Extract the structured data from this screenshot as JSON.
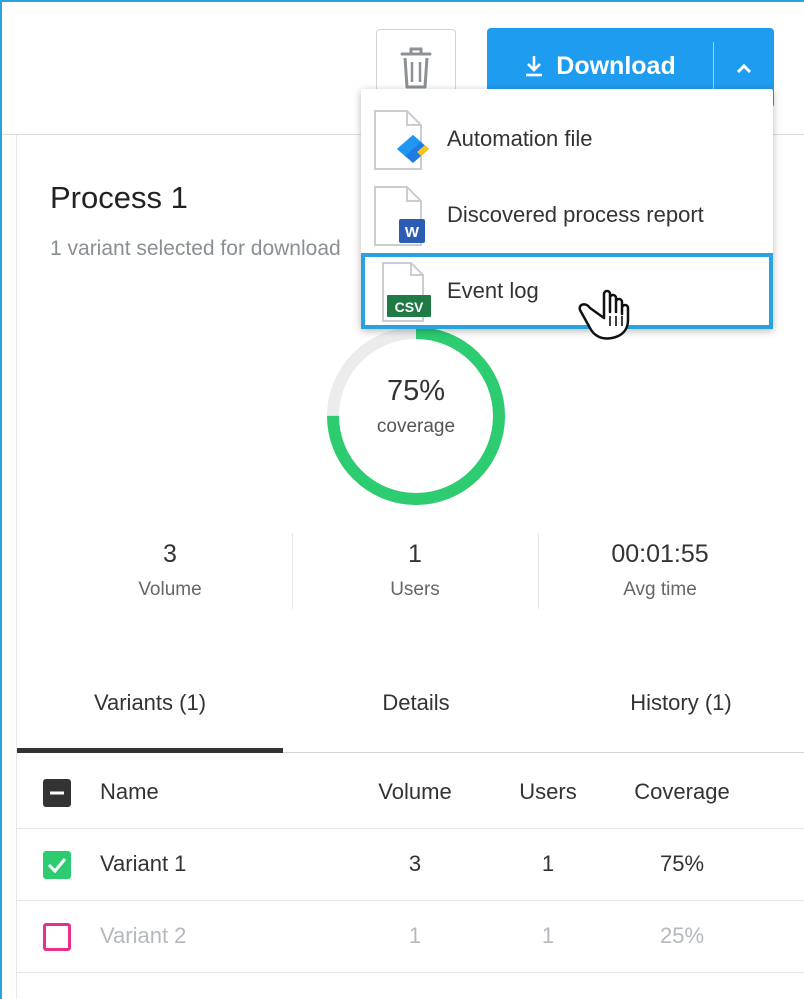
{
  "toolbar": {
    "delete_icon": "trash-icon",
    "download_label": "Download",
    "download_icon": "download-arrow-icon",
    "dropdown_icon": "chevron-up-icon",
    "accent_color": "#1e9cf0"
  },
  "download_menu": {
    "items": [
      {
        "label": "Automation file",
        "icon": "automation-file-icon"
      },
      {
        "label": "Discovered process report",
        "icon": "word-document-icon",
        "badge": "W"
      },
      {
        "label": "Event log",
        "icon": "csv-file-icon",
        "badge": "CSV",
        "highlighted": true
      }
    ]
  },
  "process": {
    "title": "Process 1",
    "subtitle": "1 variant selected for download"
  },
  "coverage": {
    "value": "75%",
    "label": "coverage",
    "fraction": 0.75,
    "color": "#2ecc71"
  },
  "stats": [
    {
      "value": "3",
      "label": "Volume"
    },
    {
      "value": "1",
      "label": "Users"
    },
    {
      "value": "00:01:55",
      "label": "Avg time"
    }
  ],
  "tabs": [
    {
      "label": "Variants (1)",
      "active": true
    },
    {
      "label": "Details",
      "active": false
    },
    {
      "label": "History (1)",
      "active": false
    }
  ],
  "table": {
    "headers": [
      "Name",
      "Volume",
      "Users",
      "Coverage"
    ],
    "rows": [
      {
        "name": "Variant 1",
        "volume": "3",
        "users": "1",
        "coverage": "75%",
        "checked": true
      },
      {
        "name": "Variant 2",
        "volume": "1",
        "users": "1",
        "coverage": "25%",
        "checked": false
      }
    ]
  }
}
